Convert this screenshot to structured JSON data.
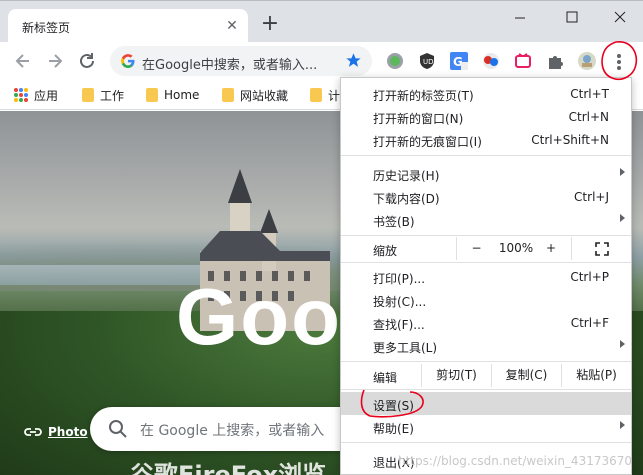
{
  "tab": {
    "title": "新标签页"
  },
  "omnibox": {
    "placeholder": "在Google中搜索，或者输入..."
  },
  "bookmarks": [
    {
      "label": "应用"
    },
    {
      "label": "工作"
    },
    {
      "label": "Home"
    },
    {
      "label": "网站收藏"
    },
    {
      "label": "计"
    }
  ],
  "page": {
    "logo_text": "Goo",
    "search_placeholder": "在 Google 上搜索，或者输入",
    "photo_label": "Photo",
    "bottom_text": "谷歌FireFox浏览"
  },
  "menu": {
    "new_tab": {
      "label": "打开新的标签页(T)",
      "shortcut": "Ctrl+T"
    },
    "new_window": {
      "label": "打开新的窗口(N)",
      "shortcut": "Ctrl+N"
    },
    "incognito": {
      "label": "打开新的无痕窗口(I)",
      "shortcut": "Ctrl+Shift+N"
    },
    "history": {
      "label": "历史记录(H)"
    },
    "downloads": {
      "label": "下载内容(D)",
      "shortcut": "Ctrl+J"
    },
    "bookmarks": {
      "label": "书签(B)"
    },
    "zoom": {
      "label": "缩放",
      "minus": "−",
      "value": "100%",
      "plus": "+"
    },
    "print": {
      "label": "打印(P)...",
      "shortcut": "Ctrl+P"
    },
    "cast": {
      "label": "投射(C)..."
    },
    "find": {
      "label": "查找(F)...",
      "shortcut": "Ctrl+F"
    },
    "more_tools": {
      "label": "更多工具(L)"
    },
    "edit": {
      "label": "编辑",
      "cut": "剪切(T)",
      "copy": "复制(C)",
      "paste": "粘贴(P)"
    },
    "settings": {
      "label": "设置(S)"
    },
    "help": {
      "label": "帮助(E)"
    },
    "exit": {
      "label": "退出(X)"
    }
  },
  "watermark": "https://blog.csdn.net/weixin_43173670",
  "colors": {
    "accent_blue": "#1a73e8",
    "annotation_red": "#e8001c",
    "menu_highlight": "#dadada"
  }
}
